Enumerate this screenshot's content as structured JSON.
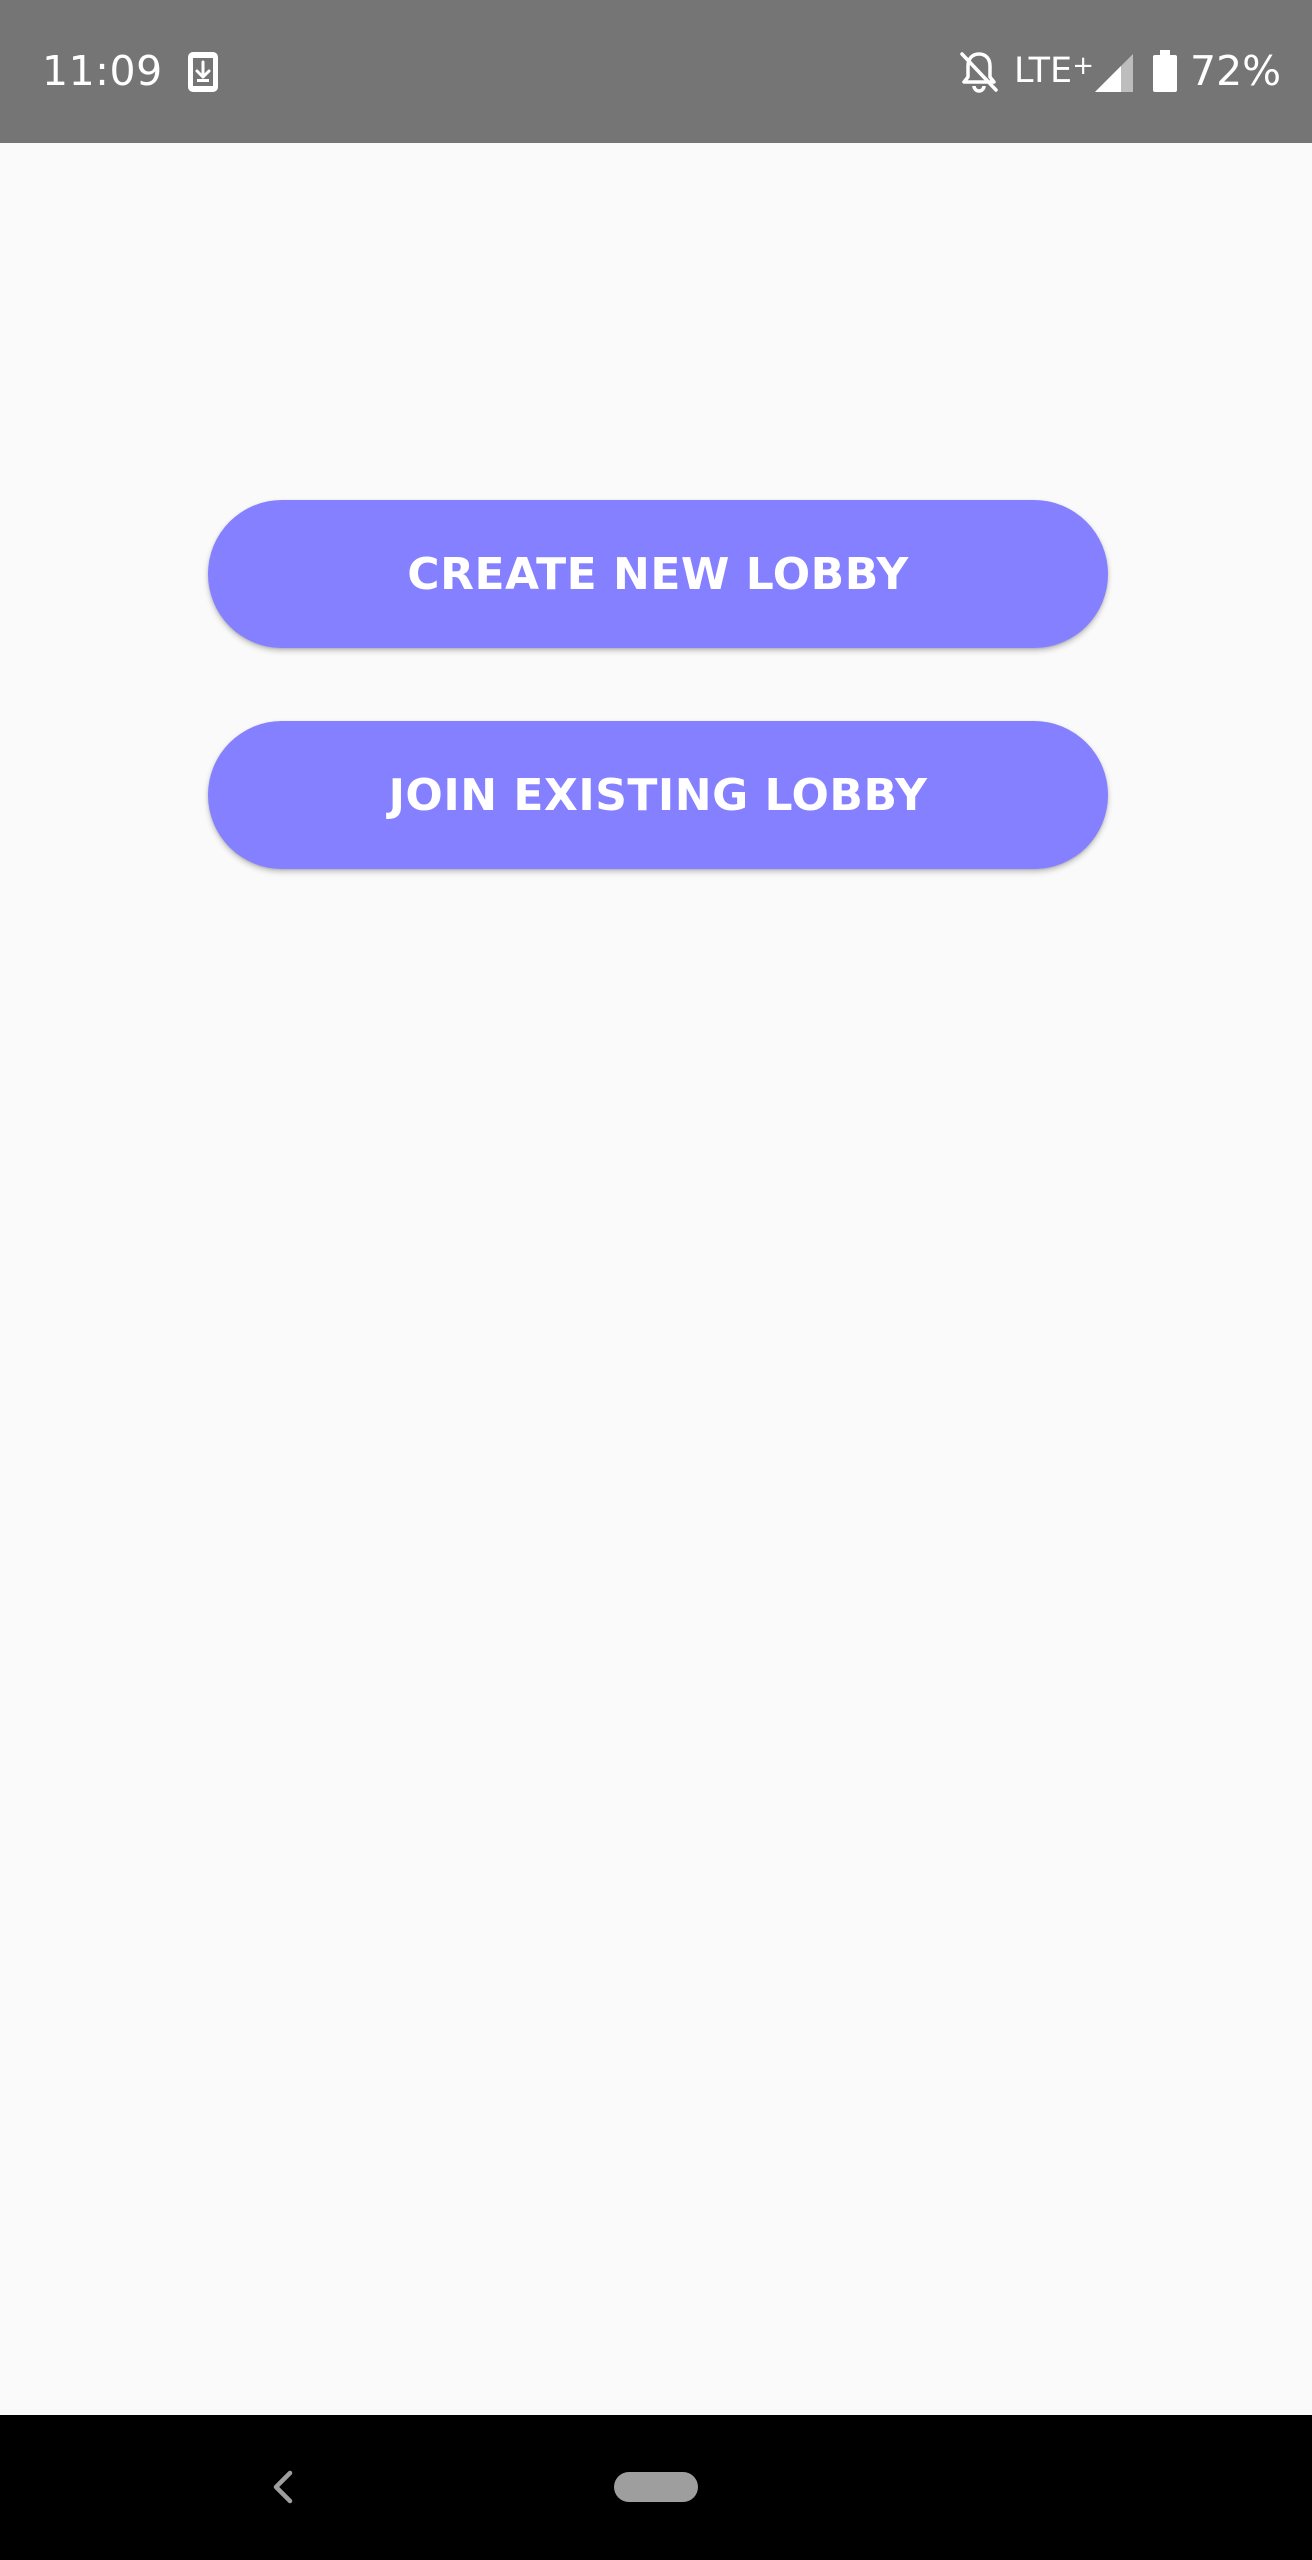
{
  "status_bar": {
    "time": "11:09",
    "network": "LTE",
    "network_suffix": "+",
    "battery_percent": "72%",
    "icons": [
      "download-icon",
      "mute-icon",
      "signal-icon",
      "battery-icon"
    ]
  },
  "main": {
    "buttons": [
      {
        "label": "CREATE NEW LOBBY"
      },
      {
        "label": "JOIN EXISTING LOBBY"
      }
    ]
  },
  "nav_bar": {
    "icons": [
      "back-icon",
      "home-handle"
    ]
  },
  "colors": {
    "status_bar_bg": "#757575",
    "background": "#fafafa",
    "button_bg": "#8480ff",
    "button_text": "#ffffff",
    "nav_bar_bg": "#000000"
  }
}
